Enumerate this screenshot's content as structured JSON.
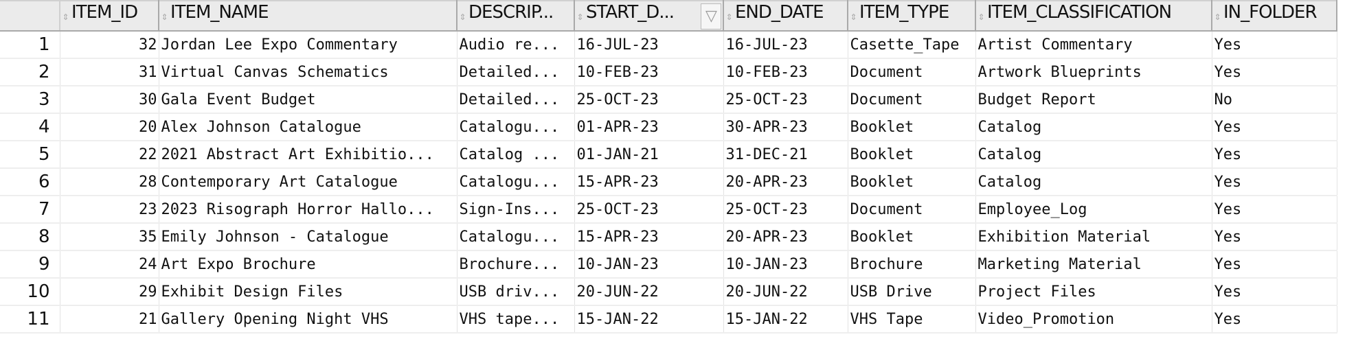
{
  "columns": [
    {
      "label": "ITEM_ID"
    },
    {
      "label": "ITEM_NAME"
    },
    {
      "label": "DESCRIP..."
    },
    {
      "label": "START_D..."
    },
    {
      "label": "END_DATE"
    },
    {
      "label": "ITEM_TYPE"
    },
    {
      "label": "ITEM_CLASSIFICATION"
    },
    {
      "label": "IN_FOLDER"
    }
  ],
  "rows": [
    {
      "n": "1",
      "id": "32",
      "name": "Jordan Lee Expo Commentary",
      "desc": "Audio re...",
      "start": "16-JUL-23",
      "end": "16-JUL-23",
      "type": "Casette_Tape",
      "cls": "Artist Commentary",
      "folder": "Yes"
    },
    {
      "n": "2",
      "id": "31",
      "name": "Virtual Canvas Schematics",
      "desc": "Detailed...",
      "start": "10-FEB-23",
      "end": "10-FEB-23",
      "type": "Document",
      "cls": "Artwork Blueprints",
      "folder": "Yes"
    },
    {
      "n": "3",
      "id": "30",
      "name": "Gala Event Budget",
      "desc": "Detailed...",
      "start": "25-OCT-23",
      "end": "25-OCT-23",
      "type": "Document",
      "cls": "Budget Report",
      "folder": "No"
    },
    {
      "n": "4",
      "id": "20",
      "name": "Alex Johnson Catalogue",
      "desc": "Catalogu...",
      "start": "01-APR-23",
      "end": "30-APR-23",
      "type": "Booklet",
      "cls": "Catalog",
      "folder": "Yes"
    },
    {
      "n": "5",
      "id": "22",
      "name": "2021 Abstract Art Exhibitio...",
      "desc": "Catalog ...",
      "start": "01-JAN-21",
      "end": "31-DEC-21",
      "type": "Booklet",
      "cls": "Catalog",
      "folder": "Yes"
    },
    {
      "n": "6",
      "id": "28",
      "name": "Contemporary Art Catalogue",
      "desc": "Catalogu...",
      "start": "15-APR-23",
      "end": "20-APR-23",
      "type": "Booklet",
      "cls": "Catalog",
      "folder": "Yes"
    },
    {
      "n": "7",
      "id": "23",
      "name": "2023 Risograph Horror Hallo...",
      "desc": "Sign-Ins...",
      "start": "25-OCT-23",
      "end": "25-OCT-23",
      "type": "Document",
      "cls": "Employee_Log",
      "folder": "Yes"
    },
    {
      "n": "8",
      "id": "35",
      "name": "Emily Johnson - Catalogue",
      "desc": "Catalogu...",
      "start": "15-APR-23",
      "end": "20-APR-23",
      "type": "Booklet",
      "cls": "Exhibition Material",
      "folder": "Yes"
    },
    {
      "n": "9",
      "id": "24",
      "name": "Art Expo Brochure",
      "desc": "Brochure...",
      "start": "10-JAN-23",
      "end": "10-JAN-23",
      "type": "Brochure",
      "cls": "Marketing Material",
      "folder": "Yes"
    },
    {
      "n": "10",
      "id": "29",
      "name": "Exhibit Design Files",
      "desc": "USB driv...",
      "start": "20-JUN-22",
      "end": "20-JUN-22",
      "type": "USB Drive",
      "cls": "Project Files",
      "folder": "Yes"
    },
    {
      "n": "11",
      "id": "21",
      "name": "Gallery Opening Night VHS",
      "desc": "VHS tape...",
      "start": "15-JAN-22",
      "end": "15-JAN-22",
      "type": "VHS Tape",
      "cls": "Video_Promotion",
      "folder": "Yes"
    }
  ]
}
